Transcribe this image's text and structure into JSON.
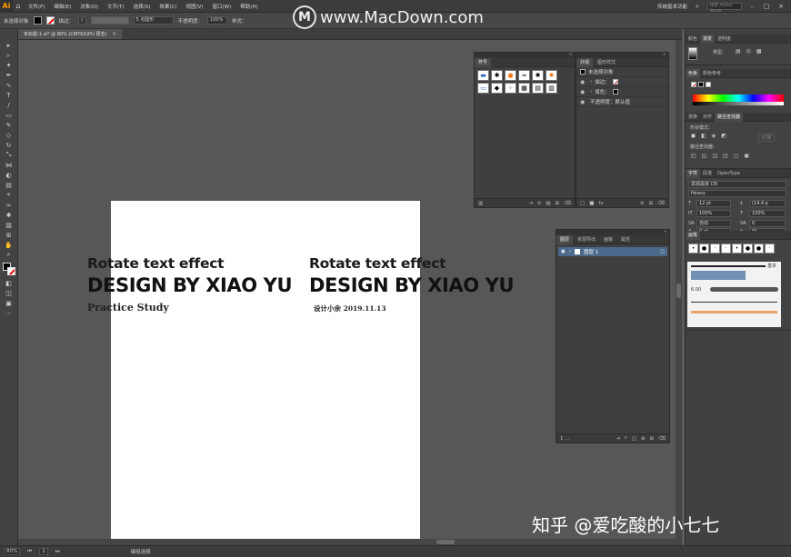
{
  "app": {
    "logo": "Ai",
    "menu": [
      "文件(F)",
      "编辑(E)",
      "对象(O)",
      "文字(T)",
      "选择(S)",
      "效果(C)",
      "视图(V)",
      "窗口(W)",
      "帮助(H)"
    ],
    "workspace": "传统基本功能",
    "search_placeholder": "搜索 Adobe Stock"
  },
  "control_bar": {
    "selection": "未选择对象",
    "stroke_label": "描边：",
    "brush": "5 点圆形",
    "opacity_label": "不透明度：",
    "opacity_value": "100%",
    "style_label": "样式："
  },
  "document": {
    "tab_title": "未标题-1.ai* @ 80% (CMYK/GPU 预览)",
    "close": "×"
  },
  "artboard": {
    "left": {
      "line1": "Rotate text effect",
      "line2": "DESIGN BY XIAO YU",
      "line3": "Practice  Study"
    },
    "right": {
      "line1": "Rotate text effect",
      "line2": "DESIGN BY XIAO YU",
      "line3": "设计小余  2019.11.13"
    }
  },
  "symbols_panel": {
    "tab": "符号",
    "symbols": [
      "▬",
      "✱",
      "●",
      "≈",
      "✺",
      "✹",
      "▭",
      "◆",
      "⁘",
      "▦",
      "▤",
      "▥"
    ]
  },
  "appearance_panel": {
    "tabs": [
      "外观",
      "图形样式"
    ],
    "rows": [
      "未选择对象",
      "描边：",
      "填色：",
      "不透明度：默认值"
    ]
  },
  "layers_panel": {
    "tabs": [
      "图层",
      "资源导出",
      "画板",
      "属性"
    ],
    "layer_name": "图层 1",
    "footer": "1 ..."
  },
  "dock": {
    "color_tabs": [
      "颜色",
      "渐变",
      "透明度"
    ],
    "type_label": "类型：",
    "swatch_tabs": [
      "色板",
      "颜色参考"
    ],
    "align_tabs": [
      "变换",
      "对齐",
      "路径查找器"
    ],
    "shape_mode_label": "形状模式：",
    "pathfinder_label": "路径查找器：",
    "expand_label": "扩展",
    "char_tabs": [
      "字符",
      "段落",
      "OpenType"
    ],
    "font_family": "思源黑体 CN",
    "font_style": "Heavy",
    "font_size": "12 pt",
    "leading": "(14.4 p",
    "tracking": "0",
    "kerning": "自动",
    "scale_h": "100%",
    "scale_v": "100%",
    "baseline": "0 pt",
    "rotation": "0°",
    "brush_tab": "画笔",
    "brush_basic": "基本",
    "brush_size": "6.00"
  },
  "status": {
    "zoom": "80%",
    "page": "1",
    "tool": "编组选择"
  },
  "watermarks": {
    "top": "www.MacDown.com",
    "top_logo": "M",
    "bottom": "知乎 @爱吃酸的小七七"
  }
}
